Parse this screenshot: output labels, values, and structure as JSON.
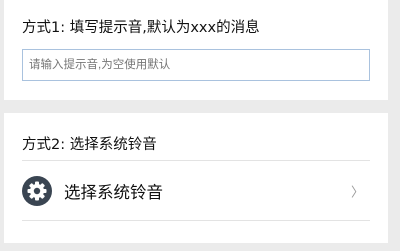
{
  "method1": {
    "title": "方式1: 填写提示音,默认为xxx的消息",
    "input_value": "",
    "input_placeholder": "请输入提示音,为空使用默认"
  },
  "method2": {
    "title": "方式2: 选择系统铃音",
    "item_label": "选择系统铃音",
    "item_icon": "gear-icon",
    "chevron_glyph": "〉"
  },
  "colors": {
    "background": "#ebebeb",
    "card": "#ffffff",
    "input_border": "#a9c2de",
    "icon": "#3a4552"
  }
}
